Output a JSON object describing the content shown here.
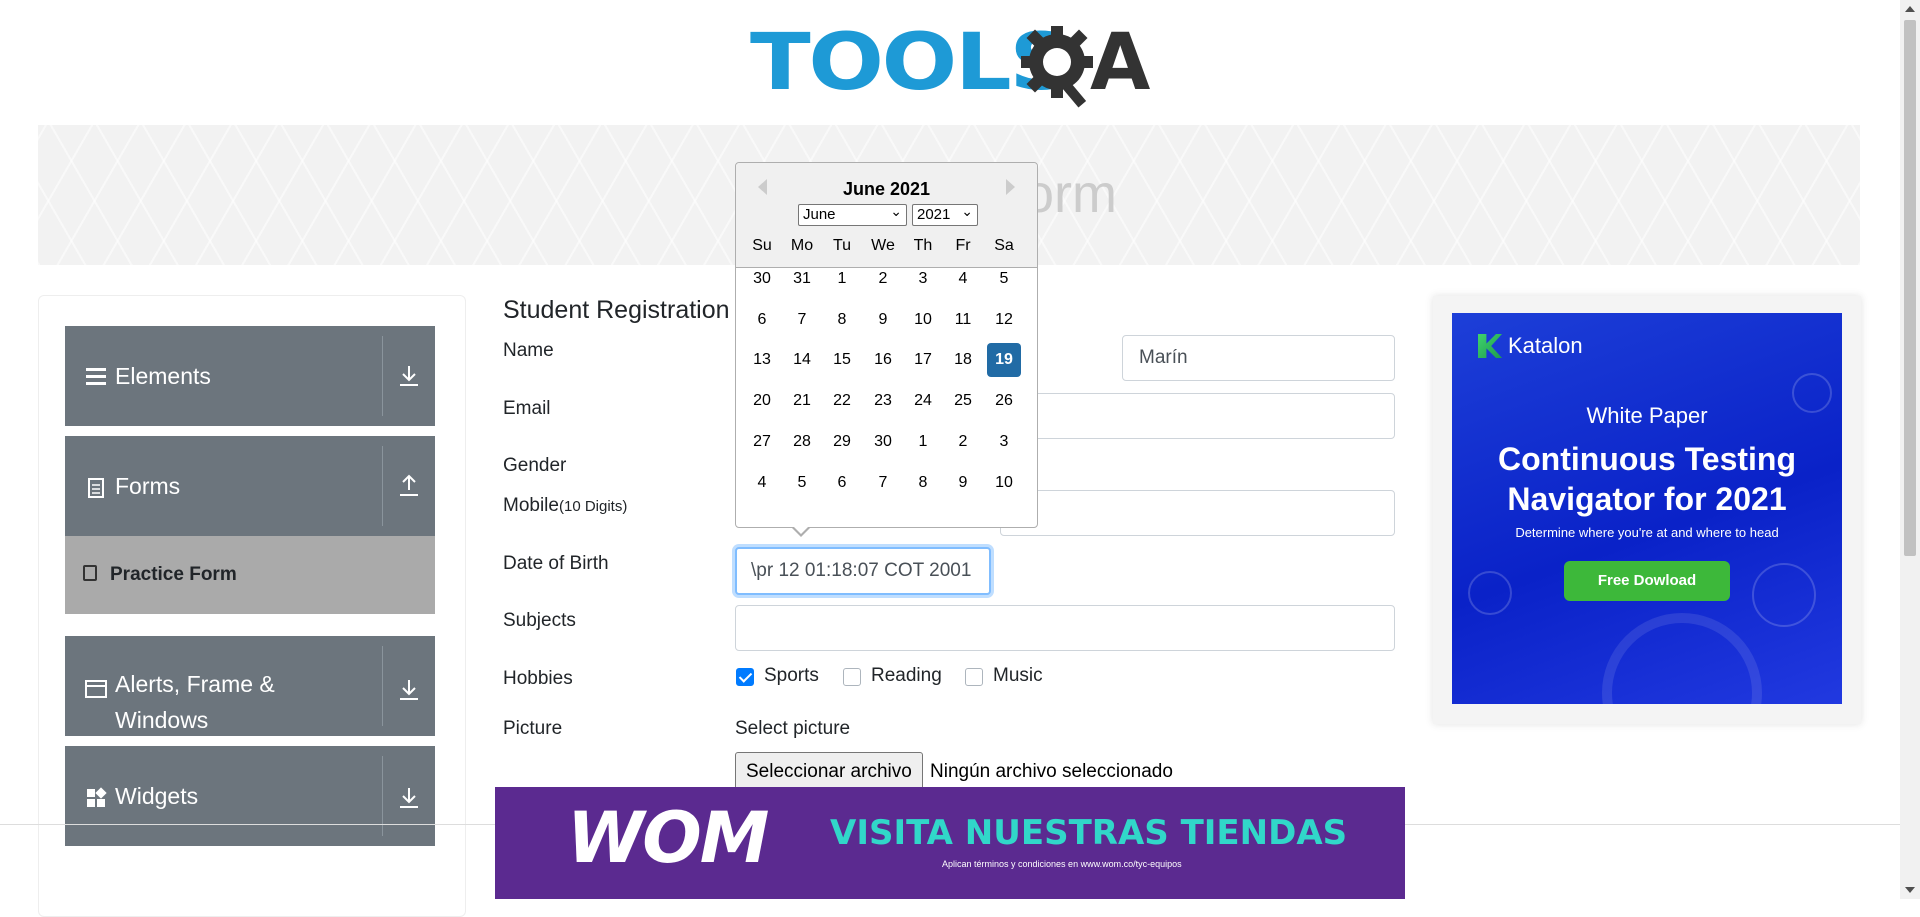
{
  "header": {
    "logo_text": "TOOLS",
    "logo_text_2": "A",
    "logo_alt": "TOOLSQA"
  },
  "banner": {
    "title": "Practice Form"
  },
  "sidebar": {
    "groups": [
      {
        "label": "Elements",
        "icon": "menu-icon",
        "arrow": "download-icon"
      },
      {
        "label": "Forms",
        "icon": "document-icon",
        "arrow": "upload-icon"
      },
      {
        "label": "Alerts, Frame & Windows",
        "icon": "window-icon",
        "arrow": "download-icon"
      },
      {
        "label": "Widgets",
        "icon": "widgets-icon",
        "arrow": "download-icon"
      }
    ],
    "active_item": "Practice Form"
  },
  "form": {
    "title": "Student Registration",
    "labels": {
      "name": "Name",
      "email": "Email",
      "gender": "Gender",
      "mobile": "Mobile",
      "mobile_hint": "(10 Digits)",
      "dob": "Date of Birth",
      "subjects": "Subjects",
      "hobbies": "Hobbies",
      "picture": "Picture"
    },
    "last_name_value": "Marín",
    "dob_value": "\\pr 12 01:18:07 COT 2001",
    "hobbies": [
      {
        "label": "Sports",
        "checked": true
      },
      {
        "label": "Reading",
        "checked": false
      },
      {
        "label": "Music",
        "checked": false
      }
    ],
    "picture_prompt": "Select picture",
    "file_button": "Seleccionar archivo",
    "file_status": "Ningún archivo seleccionado"
  },
  "datepicker": {
    "month_title": "June 2021",
    "month_select": "June",
    "year_select": "2021",
    "weekdays": [
      "Su",
      "Mo",
      "Tu",
      "We",
      "Th",
      "Fr",
      "Sa"
    ],
    "weeks": [
      [
        "30",
        "31",
        "1",
        "2",
        "3",
        "4",
        "5"
      ],
      [
        "6",
        "7",
        "8",
        "9",
        "10",
        "11",
        "12"
      ],
      [
        "13",
        "14",
        "15",
        "16",
        "17",
        "18",
        "19"
      ],
      [
        "20",
        "21",
        "22",
        "23",
        "24",
        "25",
        "26"
      ],
      [
        "27",
        "28",
        "29",
        "30",
        "1",
        "2",
        "3"
      ],
      [
        "4",
        "5",
        "6",
        "7",
        "8",
        "9",
        "10"
      ]
    ],
    "selected_day": "19",
    "selected_color": "#216ba5"
  },
  "ad_katalon": {
    "brand": "Katalon",
    "subtitle": "White Paper",
    "title_line1": "Continuous Testing",
    "title_line2": "Navigator for 2021",
    "description": "Determine where you're at and where to head",
    "button": "Free Dowload"
  },
  "ad_wom": {
    "logo": "WOM",
    "headline": "VISITA NUESTRAS TIENDAS",
    "fineprint": "Aplican términos y condiciones en www.wom.co/tyc-equipos"
  },
  "colors": {
    "sidebar_bg": "#6c757d",
    "active_item_bg": "#aaaaaa",
    "logo_blue": "#1e9ad6",
    "wom_purple": "#5b2a90",
    "wom_teal": "#31d7c9"
  }
}
